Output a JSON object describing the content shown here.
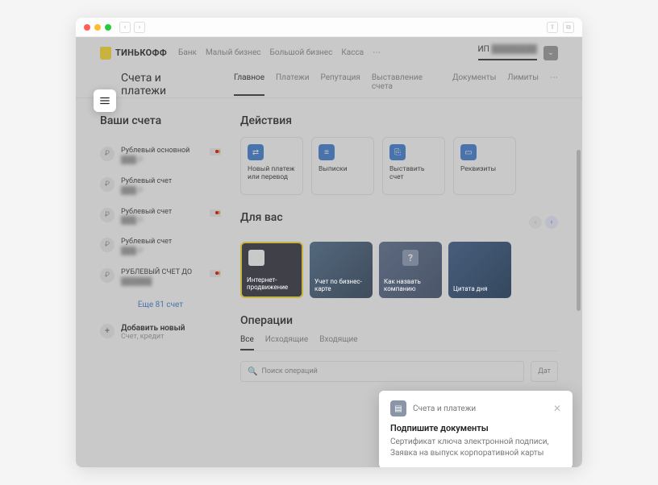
{
  "brand": {
    "name": "ТИНЬКОФФ",
    "links": [
      "Банк",
      "Малый бизнес",
      "Большой бизнес",
      "Касса"
    ],
    "user_prefix": "ИП",
    "user_name": "████████"
  },
  "section": {
    "title": "Счета и платежи",
    "tabs": [
      "Главное",
      "Платежи",
      "Репутация",
      "Выставление счета",
      "Документы",
      "Лимиты"
    ],
    "active_tab": 0
  },
  "accounts": {
    "heading": "Ваши счета",
    "items": [
      {
        "name": "Рублевый основной",
        "amount": "███ ₽",
        "card": "mc"
      },
      {
        "name": "Рублевый счет",
        "amount": "███ ₽",
        "card": ""
      },
      {
        "name": "Рублевый счет",
        "amount": "███ ₽",
        "card": "mc"
      },
      {
        "name": "Рублевый счет",
        "amount": "███ ₽",
        "card": ""
      },
      {
        "name": "РУБЛЕВЫЙ СЧЕТ ДО",
        "amount": "██████",
        "card": "mc"
      }
    ],
    "more": "Еще 81 счет",
    "add": {
      "title": "Добавить новый",
      "subtitle": "Счет, кредит"
    }
  },
  "actions": {
    "heading": "Действия",
    "items": [
      {
        "icon": "transfer",
        "label": "Новый платеж или перевод"
      },
      {
        "icon": "doc",
        "label": "Выписки"
      },
      {
        "icon": "invoice",
        "label": "Выставить счет"
      },
      {
        "icon": "briefcase",
        "label": "Реквизиты"
      }
    ]
  },
  "foryou": {
    "heading": "Для вас",
    "cards": [
      {
        "title": "Интернет-продвижение"
      },
      {
        "title": "Учет по бизнес-карте"
      },
      {
        "title": "Как назвать компанию"
      },
      {
        "title": "Цитата дня"
      }
    ]
  },
  "ops": {
    "heading": "Операции",
    "tabs": [
      "Все",
      "Исходящие",
      "Входящие"
    ],
    "active": 0,
    "search_placeholder": "Поиск операций",
    "date_label": "Дат"
  },
  "toast": {
    "category": "Счета и платежи",
    "title": "Подпишите документы",
    "body": "Сертификат ключа электронной подписи, Заявка на выпуск корпоративной карты"
  }
}
